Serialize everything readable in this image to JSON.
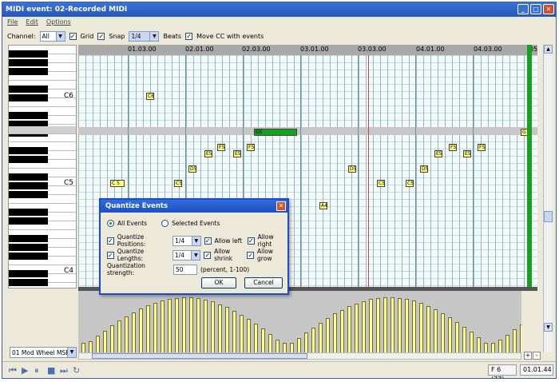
{
  "window": {
    "title": "MIDI event: 02-Recorded MIDI"
  },
  "menu": [
    "File",
    "Edit",
    "Options"
  ],
  "toolbar": {
    "channel_label": "Channel:",
    "channel_value": "All",
    "grid_label": "Grid",
    "snap_label": "Snap",
    "snap_value": "1/4",
    "beats_label": "Beats",
    "move_cc_label": "Move CC with events",
    "grid_checked": true,
    "snap_checked": true,
    "move_cc_checked": true
  },
  "ruler": {
    "labels": [
      "01.03.00",
      "02.01.00",
      "02.03.00",
      "03.01.00",
      "03.03.00",
      "04.01.00",
      "04.03.00",
      "05."
    ]
  },
  "piano": {
    "octave_labels": [
      "C6",
      "C5",
      "C4"
    ]
  },
  "notes": [
    {
      "label": "C6"
    },
    {
      "label": "G5"
    },
    {
      "label": "E5"
    },
    {
      "label": "F5"
    },
    {
      "label": "E5"
    },
    {
      "label": "F5"
    },
    {
      "label": "D5"
    },
    {
      "label": "C5"
    },
    {
      "label": "C 5"
    },
    {
      "label": "A4"
    },
    {
      "label": "D5"
    },
    {
      "label": "C5"
    },
    {
      "label": "C5"
    },
    {
      "label": "D5"
    },
    {
      "label": "E5"
    },
    {
      "label": "F5"
    },
    {
      "label": "E5"
    },
    {
      "label": "F5"
    },
    {
      "label": "G"
    }
  ],
  "controller": {
    "selected": "01 Mod Wheel MSB"
  },
  "status": {
    "note": "F 6 (77)",
    "time": "01.01.44"
  },
  "dialog": {
    "title": "Quantize Events",
    "all_events": "All Events",
    "selected_events": "Selected Events",
    "quantize_positions": "Quantize Positions:",
    "positions_value": "1/4",
    "allow_left": "Allow left",
    "allow_right": "Allow right",
    "quantize_lengths": "Quantize Lengths:",
    "lengths_value": "1/4",
    "allow_shrink": "Allow shrink",
    "allow_grow": "Allow grow",
    "strength_label": "Quantization strength:",
    "strength_value": "50",
    "strength_hint": "(percent, 1-100)",
    "ok": "OK",
    "cancel": "Cancel"
  },
  "colors": {
    "titlebar": "#2a5fc8",
    "note_fill": "#ffff80",
    "selected_note": "#18a020",
    "playhead": "#d04040",
    "cc_bar": "#ffff90"
  },
  "icons": {
    "transport": [
      "skip-back-icon",
      "play-icon",
      "pause-icon",
      "stop-icon",
      "skip-forward-icon",
      "loop-icon"
    ]
  }
}
